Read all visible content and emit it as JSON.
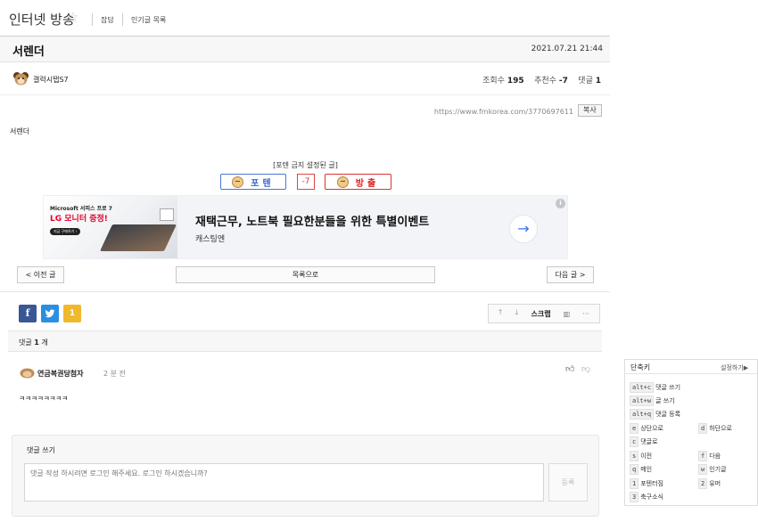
{
  "header": {
    "board_title": "인터넷 방송",
    "links": [
      "잡담",
      "인기글 목록"
    ]
  },
  "post": {
    "title": "서렌더",
    "date": "2021.07.21 21:44",
    "author": "갤럭시탭S7",
    "stats": {
      "views_label": "조회수",
      "views": "195",
      "votes_label": "추천수",
      "votes": "-7",
      "comments_label": "댓글",
      "comments": "1"
    },
    "url": "https://www.fmkorea.com/3770697611",
    "copy_label": "복사",
    "body": "서렌더",
    "vote_notice": "[포텐 금지 설정된 글]",
    "vote_up_label": "포텐",
    "vote_score": "-7",
    "vote_down_label": "방출"
  },
  "ad": {
    "thumb_line1": "Microsoft 서피스 프로 7",
    "thumb_line2": "LG 모니터 증정!",
    "thumb_cta": "지금 구매하기 ›",
    "headline": "재택근무, 노트북 필요한분들을 위한 특별이벤트",
    "advertiser": "캐스팅엔"
  },
  "nav": {
    "prev": "< 이전 글",
    "list": "목록으로",
    "next": "다음 글 >"
  },
  "share": {
    "facebook": "f",
    "etc": "1"
  },
  "toolbar": {
    "scrap": "스크랩"
  },
  "comments": {
    "label": "댓글",
    "count": "1",
    "suffix": "개",
    "items": [
      {
        "author": "연금복권당첨자",
        "time": "2 분 전",
        "text": "ㅋㅋㅋㅋㅋㅋㅋㅋ"
      }
    ]
  },
  "comment_form": {
    "title": "댓글 쓰기",
    "placeholder": "댓글 작성 하시려면 로그인 해주세요. 로그인 하시겠습니까?",
    "submit": "등록"
  },
  "shortcuts": {
    "title": "단축키",
    "settings": "설정하기▶",
    "combos": [
      {
        "key": "alt+c",
        "label": "댓글 쓰기"
      },
      {
        "key": "alt+w",
        "label": "글 쓰기"
      },
      {
        "key": "alt+q",
        "label": "댓글 등록"
      }
    ],
    "pairs": [
      [
        {
          "key": "e",
          "label": "상단으로"
        },
        {
          "key": "d",
          "label": "하단으로"
        }
      ],
      [
        {
          "key": "c",
          "label": "댓글로"
        },
        null
      ],
      [
        {
          "key": "s",
          "label": "이전"
        },
        {
          "key": "f",
          "label": "다음"
        }
      ],
      [
        {
          "key": "q",
          "label": "메인"
        },
        {
          "key": "w",
          "label": "인기글"
        }
      ],
      [
        {
          "key": "1",
          "label": "포텐터짐"
        },
        {
          "key": "2",
          "label": "유머"
        }
      ],
      [
        {
          "key": "3",
          "label": "축구소식"
        },
        null
      ]
    ]
  }
}
